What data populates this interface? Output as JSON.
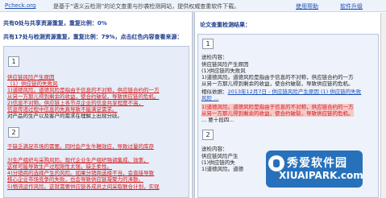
{
  "topbar": {
    "brand": "Pcheck.org",
    "desc": "是基于“语义云检测”的论文查重与抄袭检测网站，提供权威查重软件下载。",
    "link_help": "使用帮助",
    "link_upgrade": "软件升级"
  },
  "left": {
    "stat1_prefix": "共有0处与共享资源重复，重复比例：",
    "stat1_value": "0%",
    "stat2": "共有17处与检测资源重复，重复比例：79%，点击红色内容查看来源：",
    "box1": "1",
    "lines": [
      {
        "t": "供应链风险产生原因",
        "c": "red"
      },
      {
        "t": "（1）供应链的失败风",
        "c": "red"
      },
      {
        "t": "1)道德风险。道德风险是指由于信息的不对称，供应链合约的一方",
        "c": "red"
      },
      {
        "t": "从另一方那儿得到剩余的收益，使合约破裂，导致供应链的危机。",
        "c": "red"
      },
      {
        "t": "2)信息不对称。供应链上各节点企业的信息共享程度不高，",
        "c": "red"
      },
      {
        "t": "信息传递过程中信息的失真导致不能满足需求。",
        "c": "red"
      },
      {
        "t": "对产品的生产以及客户的需求在理解上出现分歧。",
        "c": "blk"
      }
    ],
    "box2": "2",
    "lines2": [
      {
        "t": "于缺乏满足市场的需要。同时会产生牛鞭效应，导致过量的库存",
        "c": "red"
      },
      {
        "t": "   3)生产组织与采购风险。现代企业生产组织强调集成、效率，",
        "c": "red"
      },
      {
        "t": "这样可能导致生产过程刚性太强，缺乏柔性。",
        "c": "red"
      },
      {
        "t": "   4)分销商的选择产生的风险。如果分销商选择不当，会直接导致",
        "c": "red"
      },
      {
        "t": "核心企业市场竞争的失败，也会导致供应链凝聚力的涣散。",
        "c": "red"
      },
      {
        "t": "5)物流运作风险。这就需要供应链各成员之间采取联合计划，实现",
        "c": "red"
      }
    ]
  },
  "right": {
    "title": "论文查重检测结果：",
    "box1": "1",
    "sent_label": "送检内容：",
    "sent_lines": [
      "供应链风险产生原因",
      "   (1)供应链的失败风",
      "1)道德风险。道德风险是指由于信息的不对称，供应链合约的一方",
      "从另一方那儿得到剩余的收益，使合约破裂，导致供应链的危机。"
    ],
    "similar_label": "相似依据：",
    "similar_link": "2013年12月7日 - 供应链风险产生原因 (1) 供应链的失败",
    "similar_tail": "风险 ...",
    "red_lines": [
      "1)道德风险。道德风险是指由于信息的不对称，供应链合约的一方",
      "从另一方那儿得到剩余的收益，使合约破裂，导致供应链的危机。",
      "... 要十段四..."
    ],
    "box2": "2",
    "sent2_label": "送检内容：",
    "sent2_lines": [
      "供应链风险产生",
      "   (1)供应链的失",
      "1)道德风险。道德"
    ]
  },
  "watermark": {
    "cn": "秀爱软件园",
    "en": "XIUAIPARK.com"
  }
}
